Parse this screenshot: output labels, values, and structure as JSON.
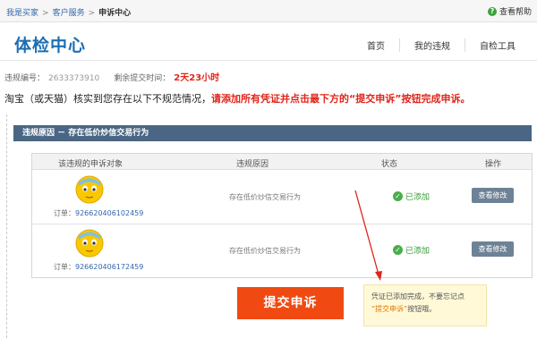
{
  "breadcrumb": {
    "items": [
      "我是买家",
      "客户服务"
    ],
    "sep": ">",
    "current": "申诉中心"
  },
  "help": {
    "label": "查看帮助",
    "icon": "question-icon"
  },
  "header": {
    "logo": "体检中心",
    "nav": [
      "首页",
      "我的违规",
      "自检工具"
    ]
  },
  "info": {
    "id_label": "违规编号：",
    "id_value": "2633373910",
    "remain_label": "剩余提交时间：",
    "remain_value": "2天23小时"
  },
  "notice": {
    "prefix": "淘宝（或天猫）核实到您存在以下不规范情况，",
    "highlight": "请添加所有凭证并点击最下方的“提交申诉”按钮完成申诉。"
  },
  "section": {
    "title": "违规原因 － 存在低价炒信交易行为"
  },
  "table": {
    "headers": [
      "该违规的申诉对象",
      "违规原因",
      "状态",
      "操作"
    ],
    "rows": [
      {
        "order_label": "订单：",
        "order_no": "926620406102459",
        "reason": "存在低价炒信交易行为",
        "status": "已添加",
        "action": "查看修改"
      },
      {
        "order_label": "订单：",
        "order_no": "926620406172459",
        "reason": "存在低价炒信交易行为",
        "status": "已添加",
        "action": "查看修改"
      }
    ]
  },
  "submit": {
    "label": "提交申诉"
  },
  "tip": {
    "line1": "凭证已添加完成，不要忘记点",
    "line2_highlight": "“提交申诉”",
    "line2_rest": "按钮哦。"
  },
  "colors": {
    "accent": "#1d6eb5",
    "warning": "#e0251b",
    "submit": "#f04a12",
    "section_bar": "#4a6684",
    "ok": "#4aae4a"
  }
}
